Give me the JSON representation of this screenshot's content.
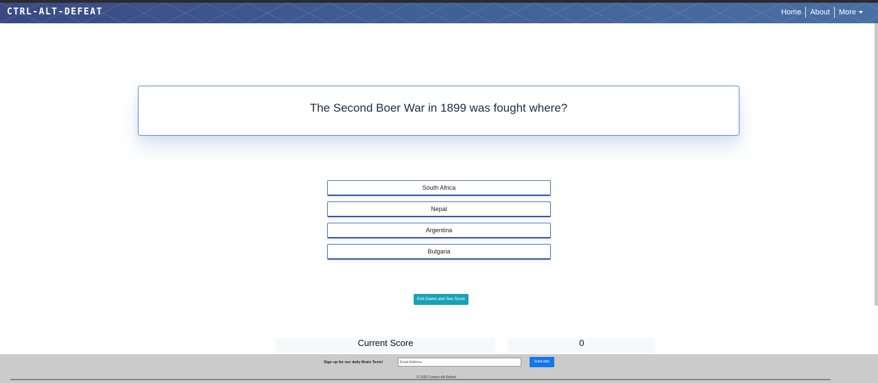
{
  "brand": {
    "title": "CTRL-ALT-DEFEAT"
  },
  "nav": {
    "home": "Home",
    "about": "About",
    "more": "More"
  },
  "quiz": {
    "question": "The Second Boer War in 1899 was fought where?",
    "answers": [
      "South Africa",
      "Nepal",
      "Argentina",
      "Bulgaria"
    ],
    "end_button": "End Game and See Score"
  },
  "score": {
    "label": "Current Score",
    "value": "0"
  },
  "footer": {
    "signup_text": "Sign up for our daily Brain Tests!",
    "email_placeholder": "Email Address",
    "subscribe_label": "Subscribe",
    "copyright": "© 2020 Control-Alt-Defeat"
  },
  "colors": {
    "navbar_start": "#3a4a82",
    "navbar_end": "#4a6fa5",
    "answer_border": "#4a78c8",
    "end_button": "#17a2b8",
    "subscribe_button": "#1476e8",
    "footer_bg": "#cbcbcb"
  }
}
